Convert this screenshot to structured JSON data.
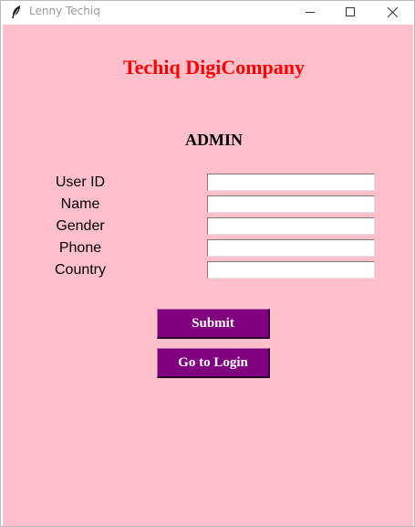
{
  "window": {
    "title": "Lenny Techiq",
    "icon": "feather-icon",
    "controls": [
      "minimize-icon",
      "maximize-icon",
      "close-icon"
    ]
  },
  "header": {
    "company": "Techiq DigiCompany",
    "role": "ADMIN"
  },
  "form": {
    "fields": [
      {
        "label": "User ID",
        "value": ""
      },
      {
        "label": "Name",
        "value": ""
      },
      {
        "label": "Gender",
        "value": ""
      },
      {
        "label": "Phone",
        "value": ""
      },
      {
        "label": "Country",
        "value": ""
      }
    ]
  },
  "buttons": {
    "submit": "Submit",
    "login": "Go to Login"
  },
  "colors": {
    "background": "#ffc0cb",
    "title": "#ff0000",
    "button": "#800080",
    "button_text": "#ffffff"
  }
}
